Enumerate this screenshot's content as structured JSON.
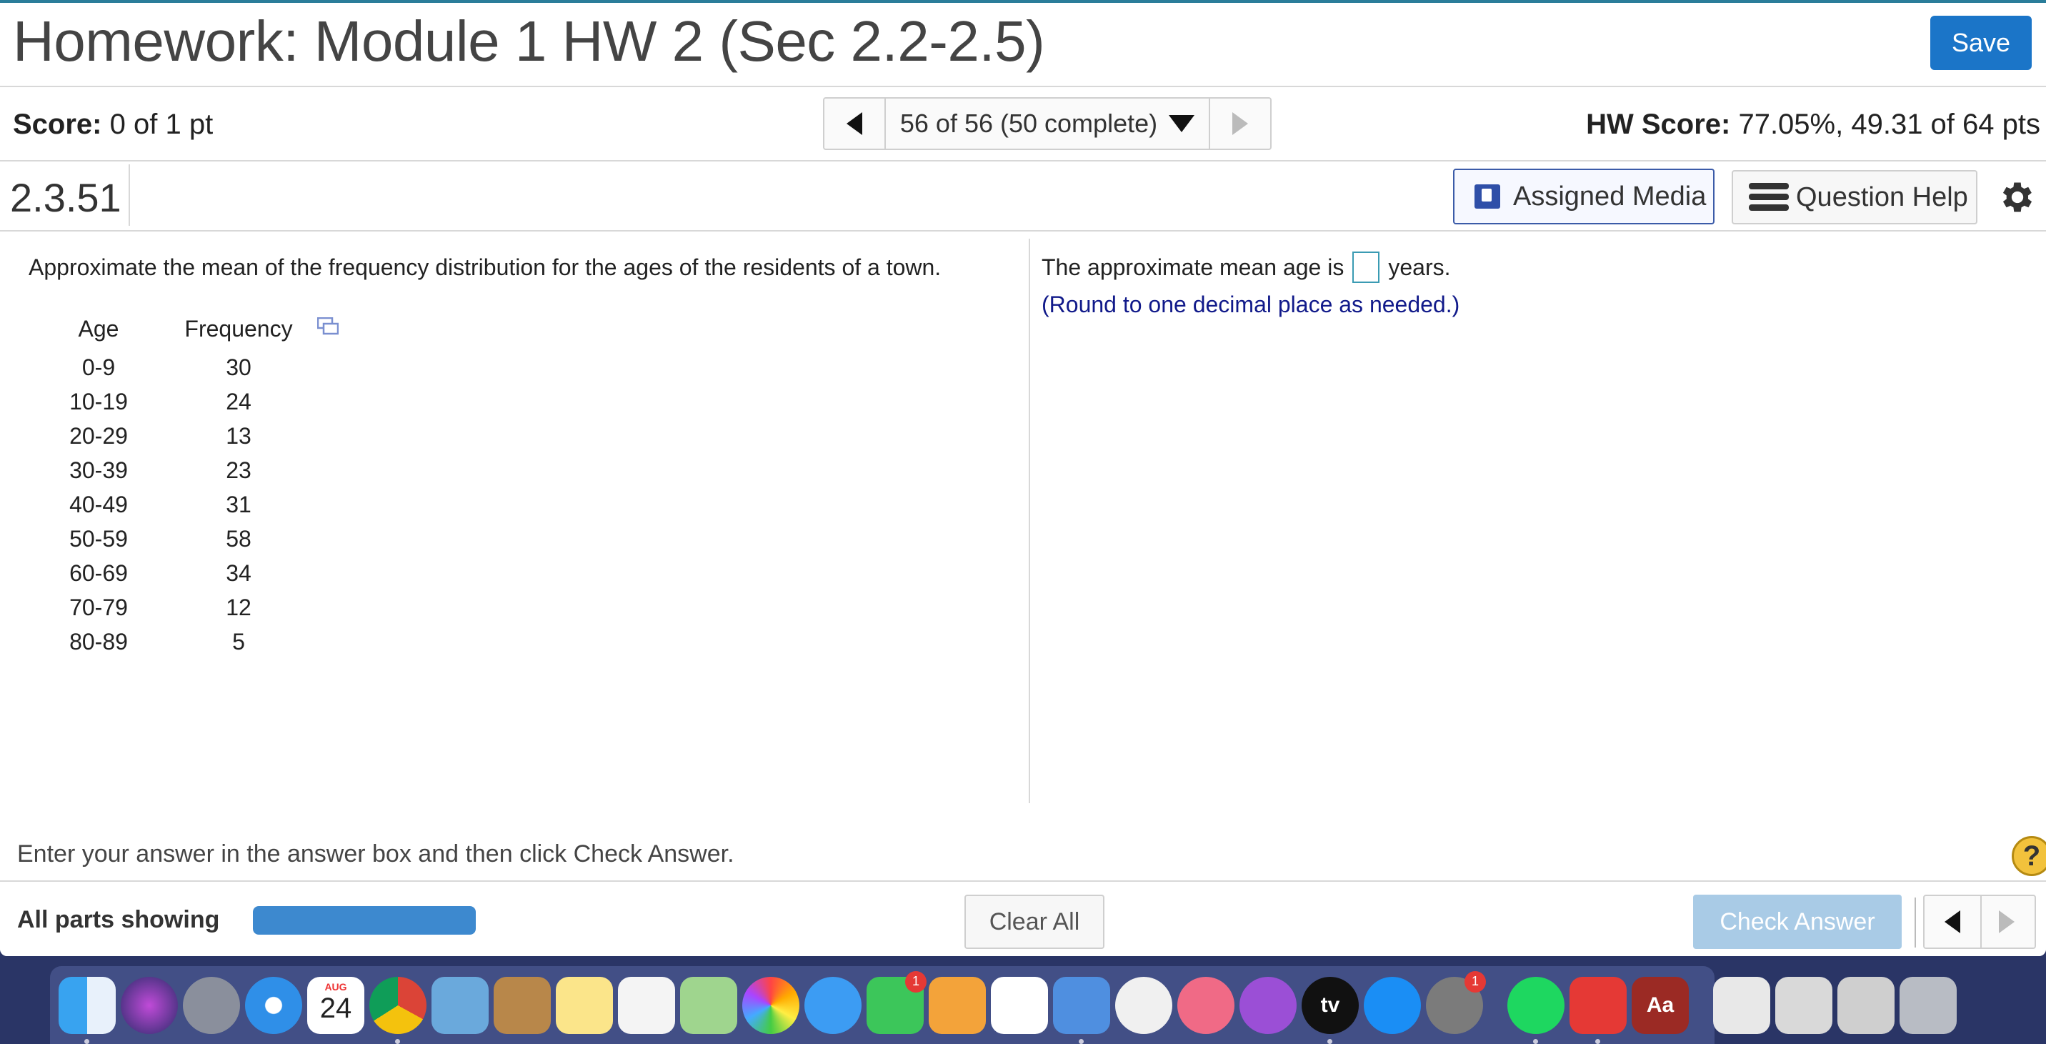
{
  "header": {
    "title": "Homework: Module 1 HW 2 (Sec 2.2-2.5)",
    "save_label": "Save"
  },
  "score": {
    "label": "Score:",
    "value": "0 of 1 pt",
    "hw_label": "HW Score:",
    "hw_value": "77.05%, 49.31 of 64 pts"
  },
  "question_nav": {
    "current": "56 of 56 (50 complete)"
  },
  "question": {
    "id": "2.3.51",
    "assigned_media_label": "Assigned Media",
    "question_help_label": "Question Help",
    "prompt": "Approximate the mean of the frequency distribution for the ages of the residents of a town.",
    "table": {
      "headers": [
        "Age",
        "Frequency"
      ],
      "rows": [
        [
          "0-9",
          "30"
        ],
        [
          "10-19",
          "24"
        ],
        [
          "20-29",
          "13"
        ],
        [
          "30-39",
          "23"
        ],
        [
          "40-49",
          "31"
        ],
        [
          "50-59",
          "58"
        ],
        [
          "60-69",
          "34"
        ],
        [
          "70-79",
          "12"
        ],
        [
          "80-89",
          "5"
        ]
      ]
    },
    "answer_prefix": "The approximate mean age is",
    "answer_value": "",
    "answer_suffix": "years.",
    "round_note": "(Round to one decimal place as needed.)"
  },
  "instructions": "Enter your answer in the answer box and then click Check Answer.",
  "bottom": {
    "parts_label": "All parts showing",
    "progress_fraction": 1.0,
    "clear_all_label": "Clear All",
    "check_answer_label": "Check Answer",
    "help_symbol": "?"
  },
  "colors": {
    "accent": "#1b75c8",
    "note_text": "#111a8a",
    "progress": "#3d89cf",
    "check_disabled": "#a9cbe6"
  },
  "dock": {
    "calendar_month": "AUG",
    "calendar_day": "24",
    "tv_label": "tv",
    "dictionary_label": "Aa",
    "facetime_badge": "1",
    "prefs_badge": "1",
    "apps": [
      "finder-icon",
      "siri-icon",
      "launchpad-icon",
      "safari-icon",
      "calendar-icon",
      "chrome-icon",
      "mail-icon",
      "contacts-icon",
      "notes-icon",
      "reminders-icon",
      "maps-icon",
      "photos-icon",
      "messages-icon",
      "facetime-icon",
      "pages-icon",
      "numbers-icon",
      "keynote-icon",
      "news-icon",
      "music-icon",
      "podcasts-icon",
      "tv-icon",
      "app-store-icon",
      "system-preferences-icon",
      "spotify-icon",
      "vpn-icon",
      "dictionary-icon",
      "preview-icon",
      "screenshot-icon",
      "screenshot-icon-2",
      "trash-icon"
    ]
  }
}
